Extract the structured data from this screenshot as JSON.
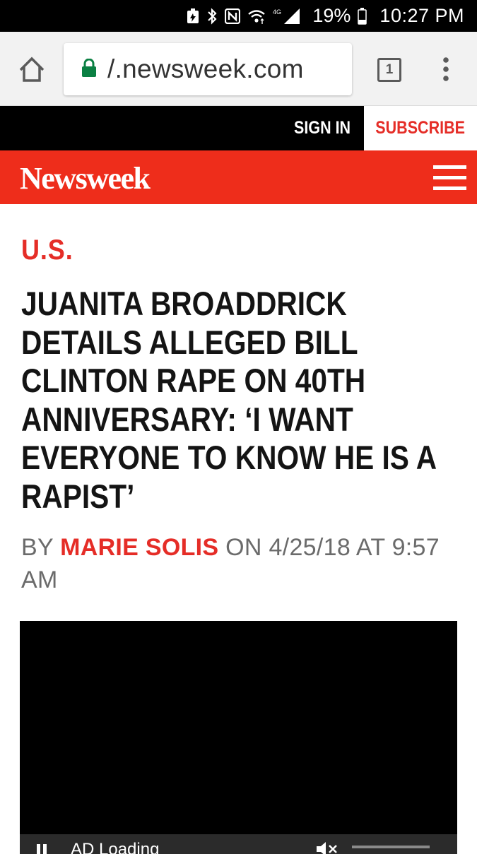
{
  "status_bar": {
    "battery_percent": "19%",
    "time": "10:27 PM",
    "icons": [
      "battery-saver-icon",
      "bluetooth-icon",
      "nfc-icon",
      "wifi-icon",
      "lte-icon",
      "signal-icon",
      "battery-icon"
    ]
  },
  "browser": {
    "url": "/.newsweek.com",
    "tab_count": "1",
    "secure": true
  },
  "account_bar": {
    "sign_in_label": "SIGN IN",
    "subscribe_label": "SUBSCRIBE"
  },
  "nav": {
    "logo_text": "Newsweek"
  },
  "article": {
    "section": "U.S.",
    "headline": "JUANITA BROADDRICK DETAILS ALLEGED BILL CLINTON RAPE ON 40TH ANNIVERSARY: ‘I WANT EVERYONE TO KNOW HE IS A RAPIST’",
    "byline_prefix": "BY ",
    "author": "MARIE SOLIS",
    "byline_date": " ON 4/25/18 AT 9:57 AM"
  },
  "video": {
    "status_text": "AD Loading"
  },
  "colors": {
    "brand_red": "#ee2d1b",
    "accent_red": "#e52d27",
    "status_bar": "#000000",
    "headline_text": "#141414"
  }
}
